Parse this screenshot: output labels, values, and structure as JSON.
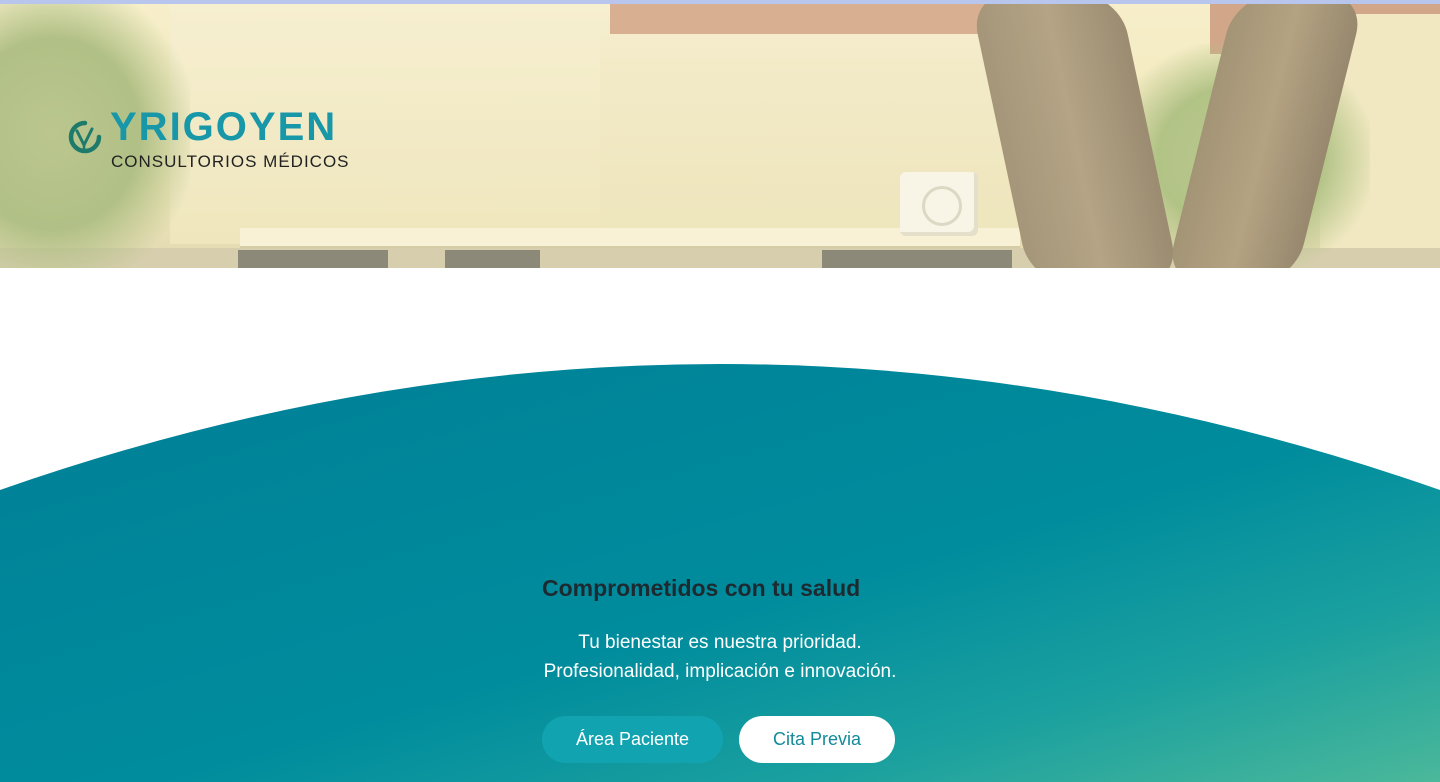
{
  "header": {
    "logo": {
      "icon": "leaf-v-icon",
      "name": "YRIGOYEN",
      "subtitle": "CONSULTORIOS MÉDICOS"
    }
  },
  "hero_section": {
    "headline": "Comprometidos con tu salud",
    "tagline_lines": [
      "Tu bienestar es nuestra prioridad.",
      "Profesionalidad, implicación e innovación."
    ],
    "buttons": {
      "patient_area": "Área Paciente",
      "appointment": "Cita Previa"
    }
  },
  "colors": {
    "brand_teal": "#1797a8",
    "section_teal_dark": "#008a9c",
    "section_teal_light": "#45b59b",
    "button_primary_bg": "#12a3b1",
    "button_secondary_bg": "#ffffff",
    "headline_text": "#1d2a30"
  }
}
